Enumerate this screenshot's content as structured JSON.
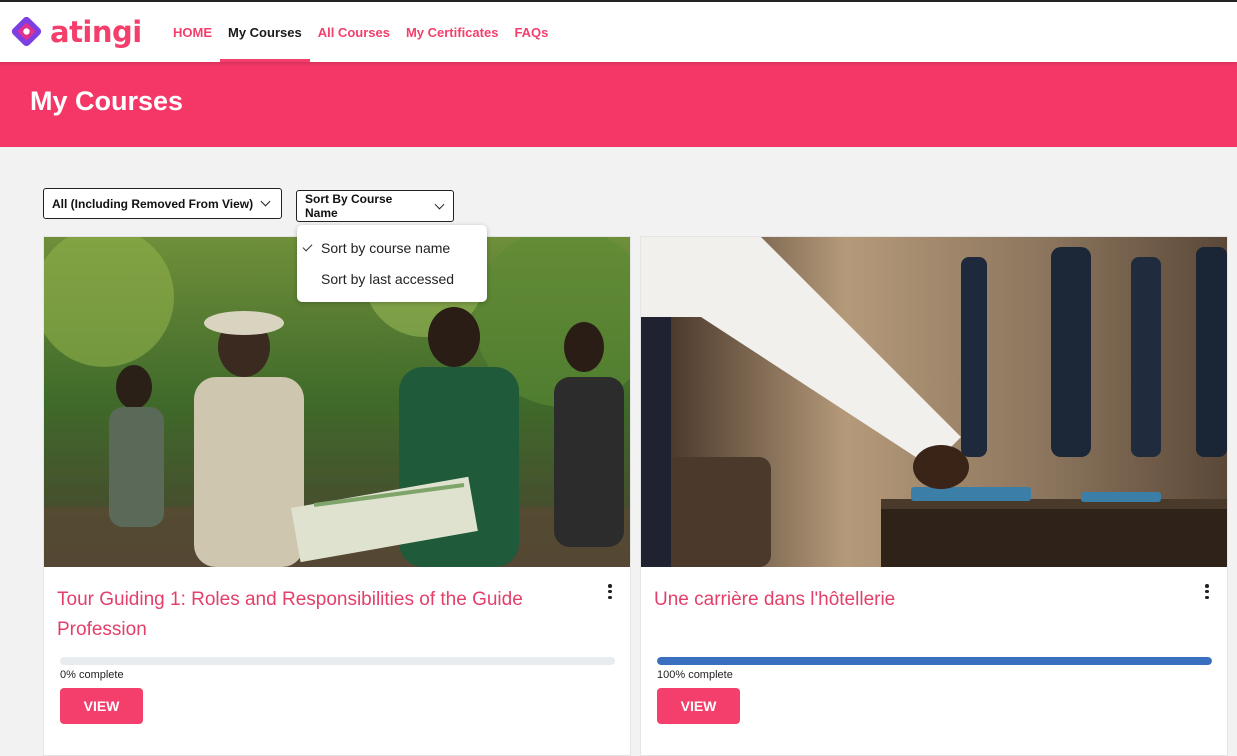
{
  "brand": {
    "name": "atingi",
    "accent": "#f43f6c"
  },
  "nav": {
    "items": [
      {
        "label": "HOME"
      },
      {
        "label": "My Courses"
      },
      {
        "label": "All Courses"
      },
      {
        "label": "My Certificates"
      },
      {
        "label": "FAQs"
      }
    ],
    "active": "My Courses"
  },
  "page": {
    "title": "My Courses"
  },
  "filters": {
    "view": {
      "selected": "All (Including Removed From View)"
    },
    "sort": {
      "selected": "Sort By Course Name",
      "options": [
        {
          "label": "Sort by course name",
          "checked": true
        },
        {
          "label": "Sort by last accessed",
          "checked": false
        }
      ]
    }
  },
  "courses": [
    {
      "title": "Tour Guiding 1: Roles and Responsibilities of the Guide Profession",
      "progress_percent": 0,
      "progress_label": "0% complete",
      "button_label": "VIEW",
      "image_icon": "tour-guides-photo"
    },
    {
      "title": "Une carrière dans l'hôtellerie",
      "progress_percent": 100,
      "progress_label": "100% complete",
      "button_label": "VIEW",
      "image_icon": "hotel-waiter-photo"
    }
  ]
}
